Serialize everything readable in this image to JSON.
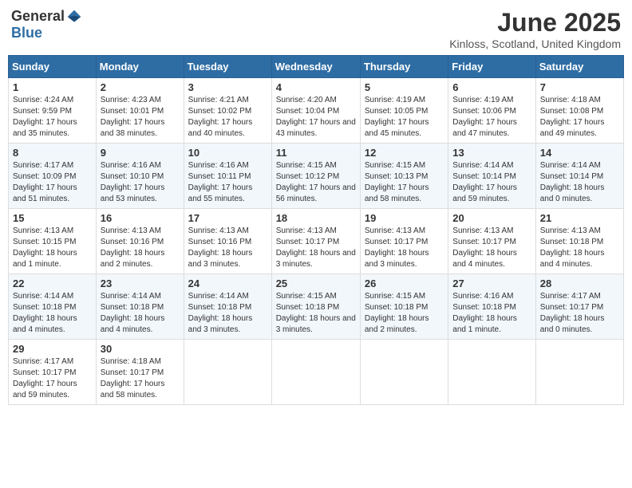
{
  "header": {
    "logo_general": "General",
    "logo_blue": "Blue",
    "month_title": "June 2025",
    "subtitle": "Kinloss, Scotland, United Kingdom"
  },
  "days_of_week": [
    "Sunday",
    "Monday",
    "Tuesday",
    "Wednesday",
    "Thursday",
    "Friday",
    "Saturday"
  ],
  "weeks": [
    [
      {
        "day": "1",
        "sunrise": "4:24 AM",
        "sunset": "9:59 PM",
        "daylight": "17 hours and 35 minutes."
      },
      {
        "day": "2",
        "sunrise": "4:23 AM",
        "sunset": "10:01 PM",
        "daylight": "17 hours and 38 minutes."
      },
      {
        "day": "3",
        "sunrise": "4:21 AM",
        "sunset": "10:02 PM",
        "daylight": "17 hours and 40 minutes."
      },
      {
        "day": "4",
        "sunrise": "4:20 AM",
        "sunset": "10:04 PM",
        "daylight": "17 hours and 43 minutes."
      },
      {
        "day": "5",
        "sunrise": "4:19 AM",
        "sunset": "10:05 PM",
        "daylight": "17 hours and 45 minutes."
      },
      {
        "day": "6",
        "sunrise": "4:19 AM",
        "sunset": "10:06 PM",
        "daylight": "17 hours and 47 minutes."
      },
      {
        "day": "7",
        "sunrise": "4:18 AM",
        "sunset": "10:08 PM",
        "daylight": "17 hours and 49 minutes."
      }
    ],
    [
      {
        "day": "8",
        "sunrise": "4:17 AM",
        "sunset": "10:09 PM",
        "daylight": "17 hours and 51 minutes."
      },
      {
        "day": "9",
        "sunrise": "4:16 AM",
        "sunset": "10:10 PM",
        "daylight": "17 hours and 53 minutes."
      },
      {
        "day": "10",
        "sunrise": "4:16 AM",
        "sunset": "10:11 PM",
        "daylight": "17 hours and 55 minutes."
      },
      {
        "day": "11",
        "sunrise": "4:15 AM",
        "sunset": "10:12 PM",
        "daylight": "17 hours and 56 minutes."
      },
      {
        "day": "12",
        "sunrise": "4:15 AM",
        "sunset": "10:13 PM",
        "daylight": "17 hours and 58 minutes."
      },
      {
        "day": "13",
        "sunrise": "4:14 AM",
        "sunset": "10:14 PM",
        "daylight": "17 hours and 59 minutes."
      },
      {
        "day": "14",
        "sunrise": "4:14 AM",
        "sunset": "10:14 PM",
        "daylight": "18 hours and 0 minutes."
      }
    ],
    [
      {
        "day": "15",
        "sunrise": "4:13 AM",
        "sunset": "10:15 PM",
        "daylight": "18 hours and 1 minute."
      },
      {
        "day": "16",
        "sunrise": "4:13 AM",
        "sunset": "10:16 PM",
        "daylight": "18 hours and 2 minutes."
      },
      {
        "day": "17",
        "sunrise": "4:13 AM",
        "sunset": "10:16 PM",
        "daylight": "18 hours and 3 minutes."
      },
      {
        "day": "18",
        "sunrise": "4:13 AM",
        "sunset": "10:17 PM",
        "daylight": "18 hours and 3 minutes."
      },
      {
        "day": "19",
        "sunrise": "4:13 AM",
        "sunset": "10:17 PM",
        "daylight": "18 hours and 3 minutes."
      },
      {
        "day": "20",
        "sunrise": "4:13 AM",
        "sunset": "10:17 PM",
        "daylight": "18 hours and 4 minutes."
      },
      {
        "day": "21",
        "sunrise": "4:13 AM",
        "sunset": "10:18 PM",
        "daylight": "18 hours and 4 minutes."
      }
    ],
    [
      {
        "day": "22",
        "sunrise": "4:14 AM",
        "sunset": "10:18 PM",
        "daylight": "18 hours and 4 minutes."
      },
      {
        "day": "23",
        "sunrise": "4:14 AM",
        "sunset": "10:18 PM",
        "daylight": "18 hours and 4 minutes."
      },
      {
        "day": "24",
        "sunrise": "4:14 AM",
        "sunset": "10:18 PM",
        "daylight": "18 hours and 3 minutes."
      },
      {
        "day": "25",
        "sunrise": "4:15 AM",
        "sunset": "10:18 PM",
        "daylight": "18 hours and 3 minutes."
      },
      {
        "day": "26",
        "sunrise": "4:15 AM",
        "sunset": "10:18 PM",
        "daylight": "18 hours and 2 minutes."
      },
      {
        "day": "27",
        "sunrise": "4:16 AM",
        "sunset": "10:18 PM",
        "daylight": "18 hours and 1 minute."
      },
      {
        "day": "28",
        "sunrise": "4:17 AM",
        "sunset": "10:17 PM",
        "daylight": "18 hours and 0 minutes."
      }
    ],
    [
      {
        "day": "29",
        "sunrise": "4:17 AM",
        "sunset": "10:17 PM",
        "daylight": "17 hours and 59 minutes."
      },
      {
        "day": "30",
        "sunrise": "4:18 AM",
        "sunset": "10:17 PM",
        "daylight": "17 hours and 58 minutes."
      },
      null,
      null,
      null,
      null,
      null
    ]
  ]
}
